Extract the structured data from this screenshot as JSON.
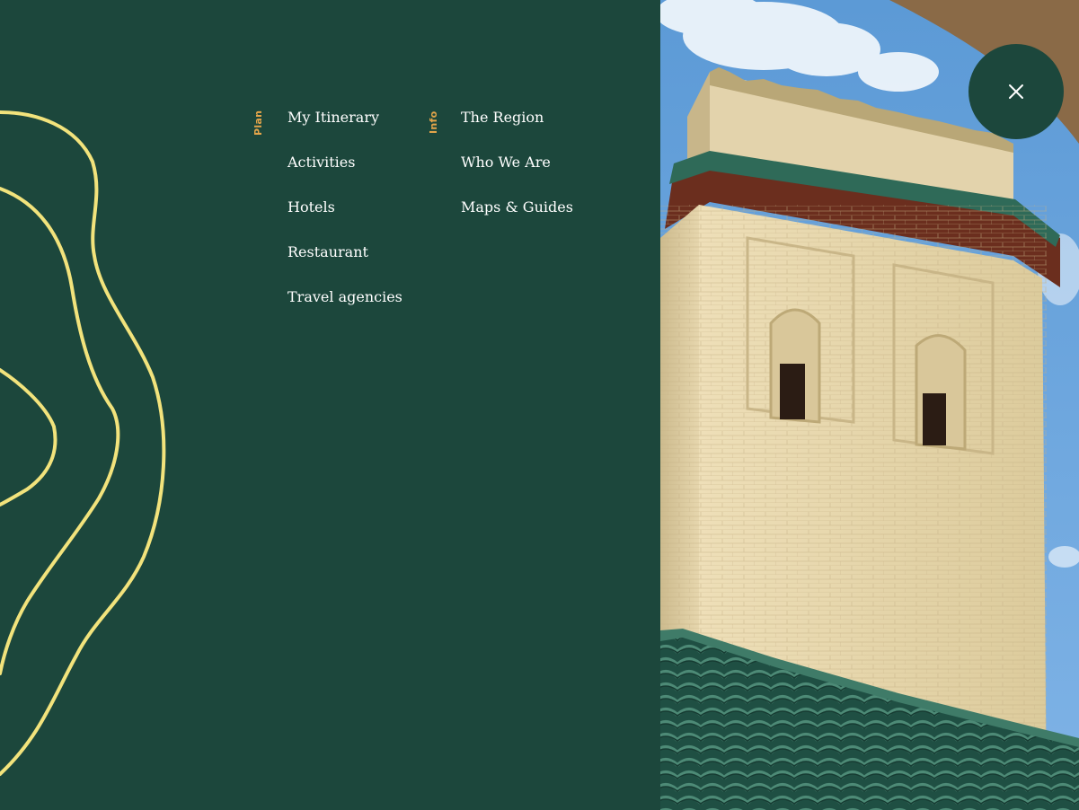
{
  "nav": {
    "plan": {
      "label": "Plan",
      "items": [
        {
          "label": "My Itinerary"
        },
        {
          "label": "Activities"
        },
        {
          "label": "Hotels"
        },
        {
          "label": "Restaurant"
        },
        {
          "label": "Travel agencies"
        }
      ]
    },
    "info": {
      "label": "Info",
      "items": [
        {
          "label": "The Region"
        },
        {
          "label": "Who We Are"
        },
        {
          "label": "Maps & Guides"
        }
      ]
    }
  },
  "decor": {
    "contour_lines": "contour-lines-graphic"
  },
  "photo": {
    "subject": "minaret-photo"
  },
  "close_button": {
    "icon": "close-icon"
  },
  "colors": {
    "panel_background": "#1c473c",
    "accent_label": "#e4a54a",
    "contour_stroke": "#f2e37c",
    "menu_text": "#ffffff",
    "sky": "#6fa7dc"
  }
}
